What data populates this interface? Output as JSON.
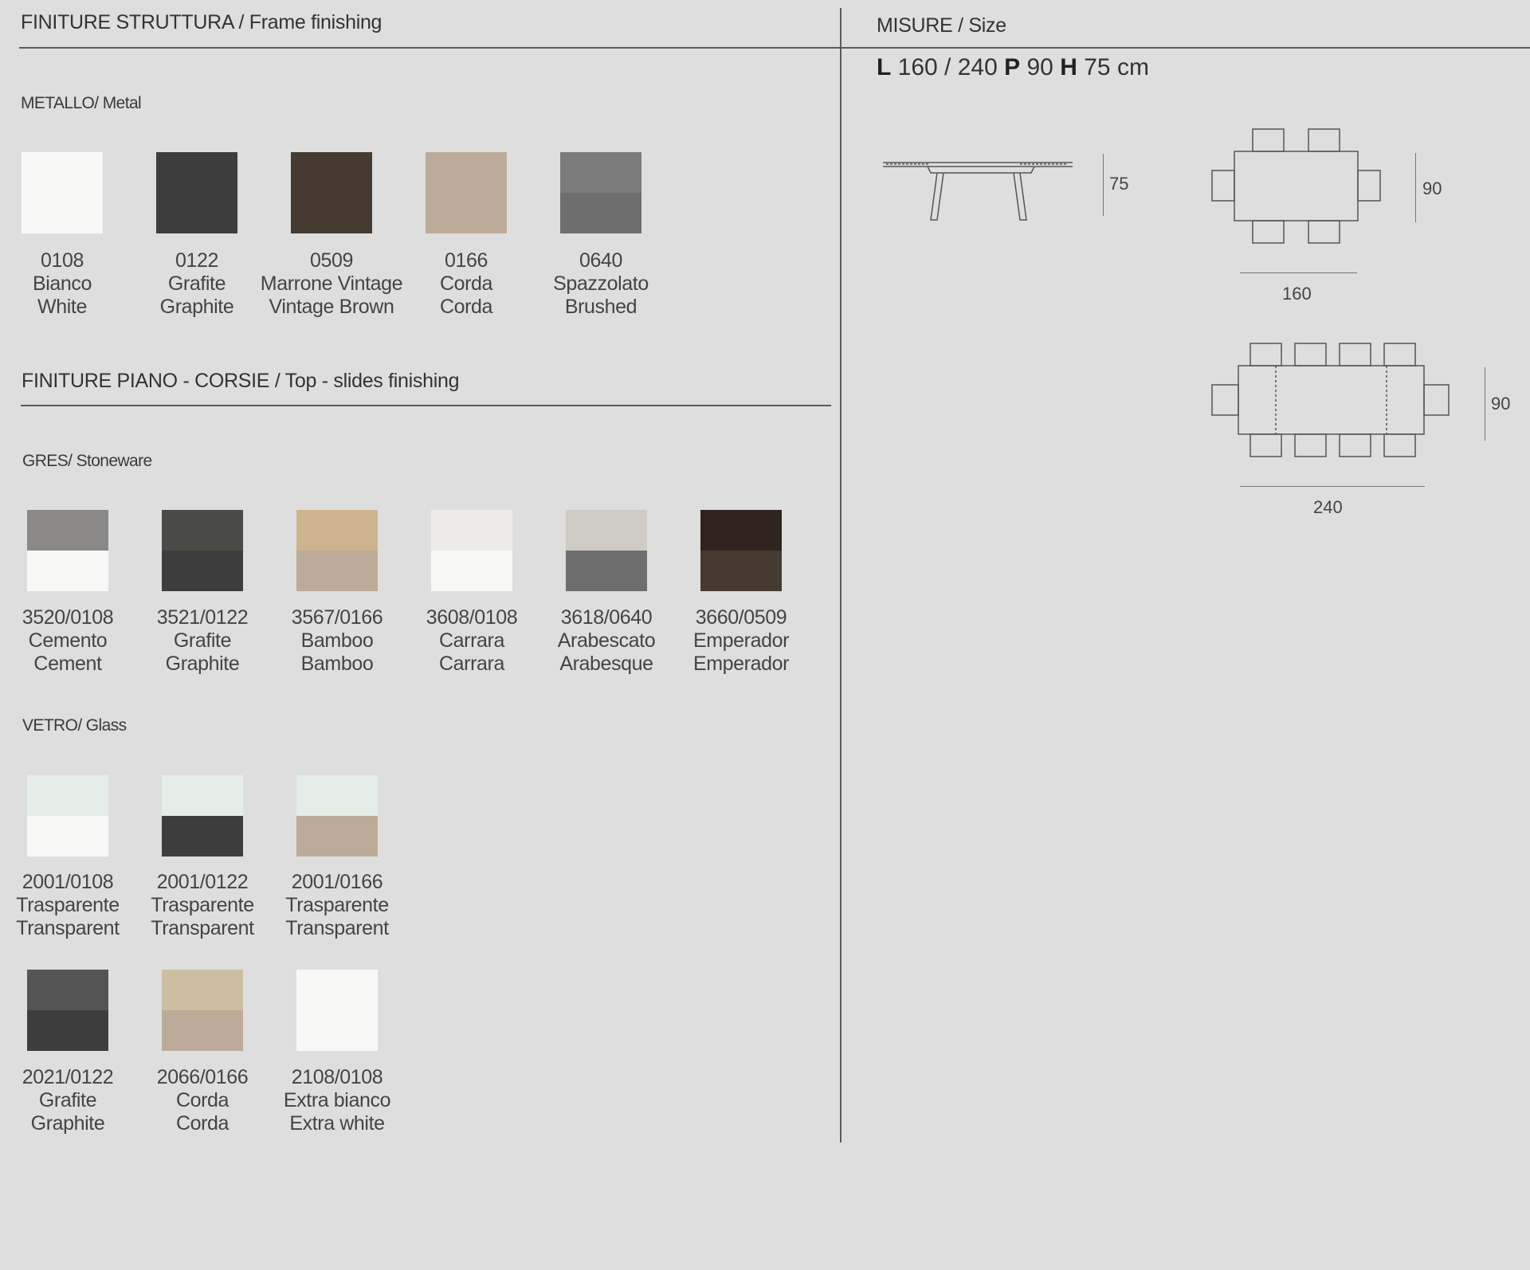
{
  "frame": {
    "header": "FINITURE STRUTTURA / Frame finishing",
    "metal_label": "METALLO/ Metal",
    "metal": [
      {
        "code": "0108",
        "it": "Bianco",
        "en": "White",
        "colors": [
          "#f8f8f6",
          "#f8f8f6"
        ]
      },
      {
        "code": "0122",
        "it": "Grafite",
        "en": "Graphite",
        "colors": [
          "#3d3d3d",
          "#3d3d3d"
        ]
      },
      {
        "code": "0509",
        "it": "Marrone Vintage",
        "en": "Vintage Brown",
        "colors": [
          "#463b31",
          "#463b31"
        ]
      },
      {
        "code": "0166",
        "it": "Corda",
        "en": "Corda",
        "colors": [
          "#bcab98",
          "#bcab98"
        ]
      },
      {
        "code": "0640",
        "it": "Spazzolato",
        "en": "Brushed",
        "colors": [
          "#7b7b7b",
          "#6e6e6e"
        ]
      }
    ]
  },
  "top": {
    "header": "FINITURE PIANO - CORSIE / Top - slides finishing",
    "stone_label": "GRES/ Stoneware",
    "stoneware": [
      {
        "code": "3520/0108",
        "it": "Cemento",
        "en": "Cement",
        "colors": [
          "#8a8987",
          "#f8f8f6"
        ]
      },
      {
        "code": "3521/0122",
        "it": "Grafite",
        "en": "Graphite",
        "colors": [
          "#4a4a46",
          "#3d3d3d"
        ]
      },
      {
        "code": "3567/0166",
        "it": "Bamboo",
        "en": "Bamboo",
        "colors": [
          "#cdb48e",
          "#bcab98"
        ]
      },
      {
        "code": "3608/0108",
        "it": "Carrara",
        "en": "Carrara",
        "colors": [
          "#ecebe8",
          "#f8f8f6"
        ]
      },
      {
        "code": "3618/0640",
        "it": "Arabescato",
        "en": "Arabesque",
        "colors": [
          "#cfccc6",
          "#6e6e6e"
        ]
      },
      {
        "code": "3660/0509",
        "it": "Emperador",
        "en": "Emperador",
        "colors": [
          "#2f241d",
          "#463b31"
        ]
      }
    ],
    "glass_label": "VETRO/ Glass",
    "glass_row1": [
      {
        "code": "2001/0108",
        "it": "Trasparente",
        "en": "Transparent",
        "colors": [
          "#e5ede9",
          "#f8f8f6"
        ]
      },
      {
        "code": "2001/0122",
        "it": "Trasparente",
        "en": "Transparent",
        "colors": [
          "#e5ede9",
          "#3d3d3d"
        ]
      },
      {
        "code": "2001/0166",
        "it": "Trasparente",
        "en": "Transparent",
        "colors": [
          "#e5ede9",
          "#bcab98"
        ]
      }
    ],
    "glass_row2": [
      {
        "code": "2021/0122",
        "it": "Grafite",
        "en": "Graphite",
        "colors": [
          "#545454",
          "#3d3d3d"
        ]
      },
      {
        "code": "2066/0166",
        "it": "Corda",
        "en": "Corda",
        "colors": [
          "#ccbea0",
          "#bcab98"
        ]
      },
      {
        "code": "2108/0108",
        "it": "Extra bianco",
        "en": "Extra white",
        "colors": [
          "#f8f8f6",
          "#f8f8f6"
        ]
      }
    ]
  },
  "size": {
    "header": "MISURE / Size",
    "l_label": "L",
    "l_value": "160 / 240",
    "p_label": "P",
    "p_value": "90",
    "h_label": "H",
    "h_value": "75 cm",
    "side_height": "75",
    "plan1_depth": "90",
    "plan1_length": "160",
    "plan2_depth": "90",
    "plan2_length": "240"
  }
}
